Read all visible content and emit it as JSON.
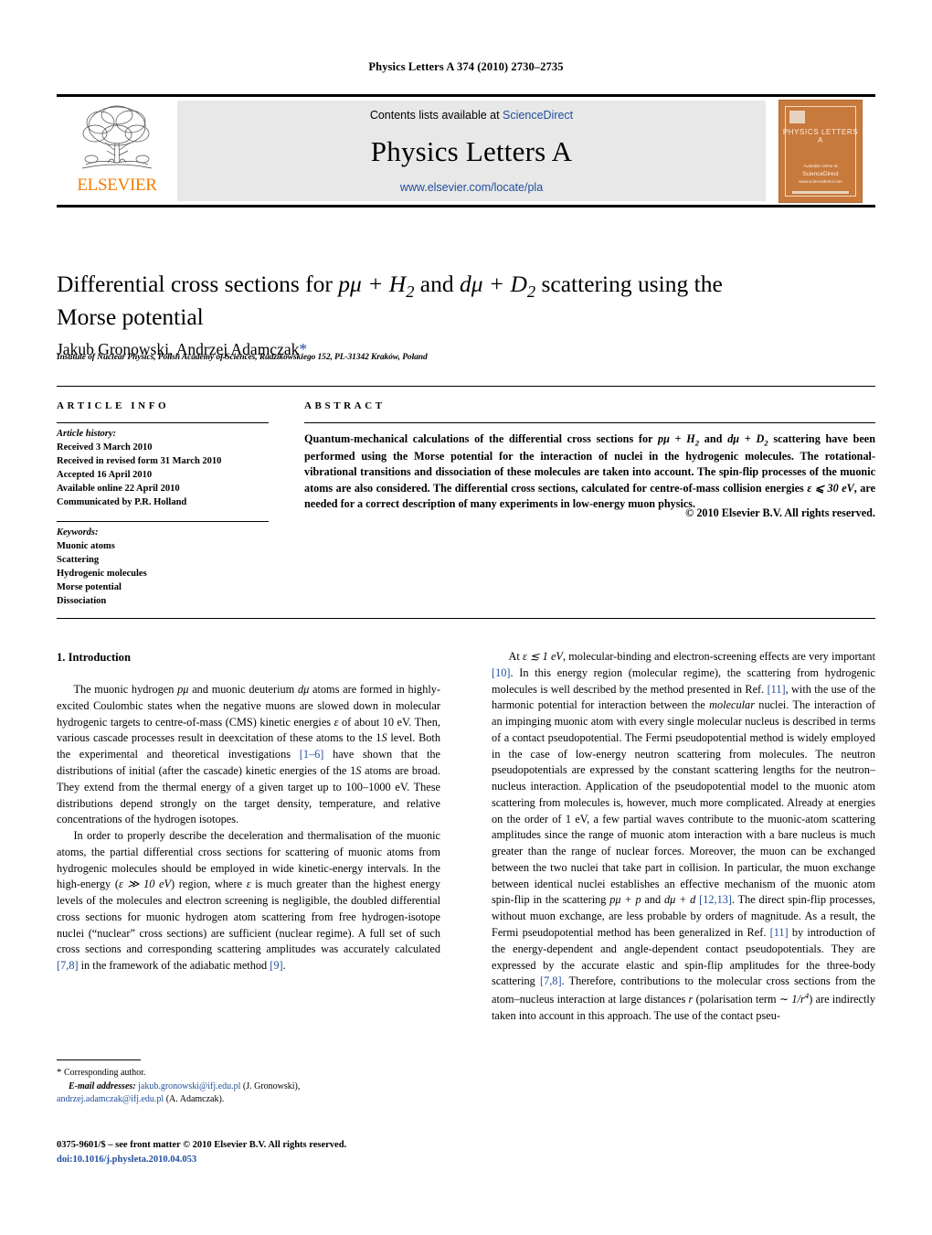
{
  "running_head": "Physics Letters A 374 (2010) 2730–2735",
  "masthead": {
    "elsevier_wordmark": "ELSEVIER",
    "contents_prefix": "Contents lists available at ",
    "sciencedirect": "ScienceDirect",
    "journal_title": "Physics Letters A",
    "journal_url": "www.elsevier.com/locate/pla",
    "cover": {
      "title": "PHYSICS LETTERS A",
      "foot_small": "Available online at",
      "foot_big": "ScienceDirect",
      "foot_tiny": "www.sciencedirect.com"
    }
  },
  "article": {
    "title_line1": "Differential cross sections for ",
    "title_math1": "pμ + H",
    "title_math1_sub": "2",
    "title_and": " and ",
    "title_math2": "dμ + D",
    "title_math2_sub": "2",
    "title_tail": " scattering using",
    "title_line2": "the Morse potential",
    "authors": "Jakub Gronowski, Andrzej Adamczak",
    "author_star": "*",
    "affiliation": "Institute of Nuclear Physics, Polish Academy of Sciences, Radzikowskiego 152, PL-31342 Kraków, Poland"
  },
  "info": {
    "heading": "ARTICLE INFO",
    "history_label": "Article history:",
    "history": [
      "Received 3 March 2010",
      "Received in revised form 31 March 2010",
      "Accepted 16 April 2010",
      "Available online 22 April 2010",
      "Communicated by P.R. Holland"
    ],
    "keywords_label": "Keywords:",
    "keywords": [
      "Muonic atoms",
      "Scattering",
      "Hydrogenic molecules",
      "Morse potential",
      "Dissociation"
    ]
  },
  "abstract": {
    "heading": "ABSTRACT",
    "part1": "Quantum-mechanical calculations of the differential cross sections for ",
    "math1": "pμ + H",
    "math1_sub": "2",
    "part2": " and ",
    "math2": "dμ + D",
    "math2_sub": "2",
    "part3": " scattering have been performed using the Morse potential for the interaction of nuclei in the hydrogenic molecules. The rotational-vibrational transitions and dissociation of these molecules are taken into account. The spin-flip processes of the muonic atoms are also considered. The differential cross sections, calculated for centre-of-mass collision energies ",
    "math3": "ε ⩽ 30 eV",
    "part4": ", are needed for a correct description of many experiments in low-energy muon physics.",
    "copyright": "© 2010 Elsevier B.V. All rights reserved."
  },
  "body": {
    "section_number_title": "1. Introduction",
    "left_p1_a": "The muonic hydrogen ",
    "left_p1_m1": "pμ",
    "left_p1_b": " and muonic deuterium ",
    "left_p1_m2": "dμ",
    "left_p1_c": " atoms are formed in highly-excited Coulombic states when the negative muons are slowed down in molecular hydrogenic targets to centre-of-mass (CMS) kinetic energies ",
    "left_p1_m3": "ε",
    "left_p1_d": " of about 10 eV. Then, various cascade processes result in deexcitation of these atoms to the 1",
    "left_p1_m4": "S",
    "left_p1_e": " level. Both the experimental and theoretical investigations ",
    "left_p1_cite1": "[1–6]",
    "left_p1_f": " have shown that the distributions of initial (after the cascade) kinetic energies of the 1",
    "left_p1_m5": "S",
    "left_p1_g": " atoms are broad. They extend from the thermal energy of a given target up to 100–1000 eV. These distributions depend strongly on the target density, temperature, and relative concentrations of the hydrogen isotopes.",
    "left_p2_a": "In order to properly describe the deceleration and thermalisation of the muonic atoms, the partial differential cross sections for scattering of muonic atoms from hydrogenic molecules should be employed in wide kinetic-energy intervals. In the high-energy (",
    "left_p2_m1": "ε ≫ 10 eV",
    "left_p2_b": ") region, where ",
    "left_p2_m2": "ε",
    "left_p2_c": " is much greater than the highest energy levels of the molecules and electron screening is negligible, the doubled differential cross sections for muonic hydrogen atom scattering from free hydrogen-isotope nuclei (“nuclear” cross sections) are sufficient (nuclear regime). A full set of such cross sections and corresponding scattering amplitudes was accurately calculated ",
    "left_p2_cite1": "[7,8]",
    "left_p2_d": " in the framework of the adiabatic method ",
    "left_p2_cite2": "[9]",
    "left_p2_e": ".",
    "right_p1_a": "At ",
    "right_p1_m1": "ε ≲ 1 eV",
    "right_p1_b": ", molecular-binding and electron-screening effects are very important ",
    "right_p1_cite1": "[10]",
    "right_p1_c": ". In this energy region (molecular regime), the scattering from hydrogenic molecules is well described by the method presented in Ref. ",
    "right_p1_cite2": "[11]",
    "right_p1_d": ", with the use of the harmonic potential for interaction between the ",
    "right_p1_it1": "molecular",
    "right_p1_e": " nuclei. The interaction of an impinging muonic atom with every single molecular nucleus is described in terms of a contact pseudopotential. The Fermi pseudopotential method is widely employed in the case of low-energy neutron scattering from molecules. The neutron pseudopotentials are expressed by the constant scattering lengths for the neutron–nucleus interaction. Application of the pseudopotential model to the muonic atom scattering from molecules is, however, much more complicated. Already at energies on the order of 1 eV, a few partial waves contribute to the muonic-atom scattering amplitudes since the range of muonic atom interaction with a bare nucleus is much greater than the range of nuclear forces. Moreover, the muon can be exchanged between the two nuclei that take part in collision. In particular, the muon exchange between identical nuclei establishes an effective mechanism of the muonic atom spin-flip in the scattering ",
    "right_p1_m2": "pμ + p",
    "right_p1_f": " and ",
    "right_p1_m3": "dμ + d",
    "right_p1_g": " ",
    "right_p1_cite3": "[12,13]",
    "right_p1_h": ". The direct spin-flip processes, without muon exchange, are less probable by orders of magnitude. As a result, the Fermi pseudopotential method has been generalized in Ref. ",
    "right_p1_cite4": "[11]",
    "right_p1_i": " by introduction of the energy-dependent and angle-dependent contact pseudopotentials. They are expressed by the accurate elastic and spin-flip amplitudes for the three-body scattering ",
    "right_p1_cite5": "[7,8]",
    "right_p1_j": ". Therefore, contributions to the molecular cross sections from the atom–nucleus interaction at large distances ",
    "right_p1_m4": "r",
    "right_p1_k": " (polarisation term ",
    "right_p1_m5": "∼ 1/r",
    "right_p1_m5_sup": "4",
    "right_p1_l": ") are indirectly taken into account in this approach. The use of the contact pseu-"
  },
  "footnotes": {
    "star": "*",
    "corresponding": "Corresponding author.",
    "email_label": "E-mail addresses:",
    "email1": "jakub.gronowski@ifj.edu.pl",
    "email1_name": " (J. Gronowski),",
    "email2": "andrzej.adamczak@ifj.edu.pl",
    "email2_name": " (A. Adamczak).",
    "imprint": "0375-9601/$ – see front matter  © 2010 Elsevier B.V. All rights reserved.",
    "doi": "doi:10.1016/j.physleta.2010.04.053"
  }
}
